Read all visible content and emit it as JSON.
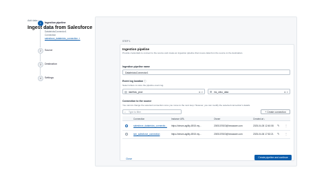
{
  "breadcrumb": "Add data",
  "page_title": "Ingest data from Salesforce",
  "steps": [
    {
      "number": "1",
      "title": "Ingestion pipeline",
      "active": true,
      "details": [
        {
          "label": "Pipeline"
        },
        {
          "label": "DatabricksConnector1"
        },
        {
          "label": "Connection"
        },
        {
          "label": "salesforce_databricks_connection"
        }
      ]
    },
    {
      "number": "2",
      "title": "Source",
      "active": false
    },
    {
      "number": "3",
      "title": "Destination",
      "active": false
    },
    {
      "number": "4",
      "title": "Settings",
      "active": false
    }
  ],
  "main": {
    "step_label": "STEP 1",
    "section_title": "Ingestion pipeline",
    "section_desc": "Provide credentials to connect to the source and create an ingestion pipeline that moves data from the source to the destination.",
    "pipeline_name_label": "Ingestion pipeline name",
    "pipeline_name_value": "DatabricksConnector1",
    "event_log_label": "Event log location",
    "event_log_desc": "Select where to store the pipeline event log.",
    "catalog_value": "lakeflow_prod",
    "schema_value": "ins_ceko_data",
    "connection_title": "Connection to the source",
    "connection_desc": "You cannot change the selected connection once you move to the next step. However, you can modify the selected connection's details.",
    "filter_placeholder": "Type to filter",
    "create_connection_label": "Create connection",
    "table_headers": [
      "Connection",
      "Instance URL",
      "Owner",
      "Created at"
    ],
    "rows": [
      {
        "selected": true,
        "connection": "salesforce_databricks_connectio...",
        "url": "https://dream-agility-8915.my...",
        "owner": "2005107603@hexaware.com",
        "created": "2025-04-05 12:40:08"
      },
      {
        "selected": false,
        "connection": "sim_salesforce_connection",
        "url": "https://dream-agility-8915.my...",
        "owner": "2005107603@hexaware.com",
        "created": "2025-04-06 17:52:21"
      }
    ],
    "close_label": "Close",
    "primary_label": "Create pipeline and continue"
  },
  "icons": {
    "info": "ⓘ",
    "external": "↗",
    "catalog": "▤",
    "schema": "⊞",
    "clear_dropdown": "⊗ ▾",
    "filter": "⌕",
    "plus": "+",
    "edit": "✎",
    "kebab": "⋮"
  },
  "colors": {
    "accent": "#0b5cab"
  }
}
